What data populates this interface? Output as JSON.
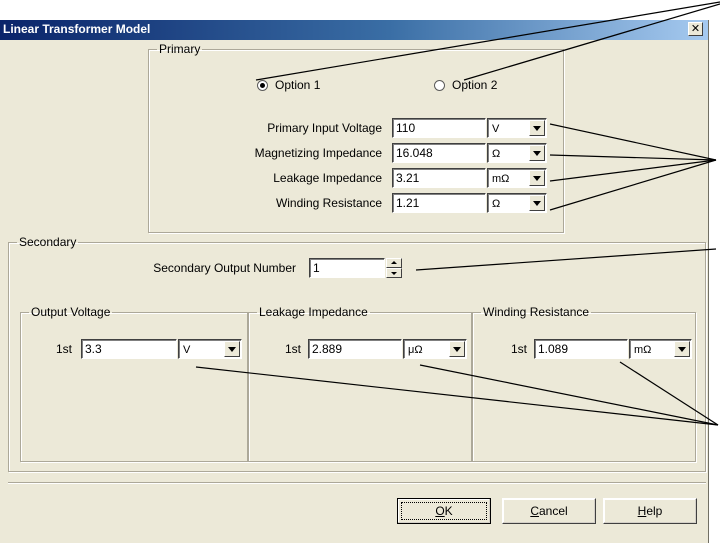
{
  "window": {
    "title": "Linear Transformer Model",
    "close_glyph": "✕"
  },
  "primary": {
    "group_label": "Primary",
    "option1": "Option 1",
    "option2": "Option 2",
    "selected": "option1",
    "rows": [
      {
        "label": "Primary Input Voltage",
        "value": "110",
        "unit": "V"
      },
      {
        "label": "Magnetizing Impedance",
        "value": "16.048",
        "unit": "Ω"
      },
      {
        "label": "Leakage Impedance",
        "value": "3.21",
        "unit": "mΩ"
      },
      {
        "label": "Winding Resistance",
        "value": "1.21",
        "unit": "Ω"
      }
    ]
  },
  "secondary": {
    "group_label": "Secondary",
    "output_number_label": "Secondary Output Number",
    "output_number_value": "1",
    "columns": [
      {
        "title": "Output Voltage",
        "row_label": "1st",
        "value": "3.3",
        "unit": "V"
      },
      {
        "title": "Leakage Impedance",
        "row_label": "1st",
        "value": "2.889",
        "unit": "μΩ"
      },
      {
        "title": "Winding Resistance",
        "row_label": "1st",
        "value": "1.089",
        "unit": "mΩ"
      }
    ]
  },
  "buttons": {
    "ok": "OK",
    "ok_mnemonic": "O",
    "ok_rest": "K",
    "cancel_mnemonic": "C",
    "cancel_rest": "ancel",
    "help_mnemonic": "H",
    "help_rest": "elp"
  },
  "colors": {
    "titlebar_start": "#0a246a",
    "titlebar_end": "#a6caf0",
    "dialog_bg": "#ece9d8",
    "callout_line": "#000000"
  }
}
